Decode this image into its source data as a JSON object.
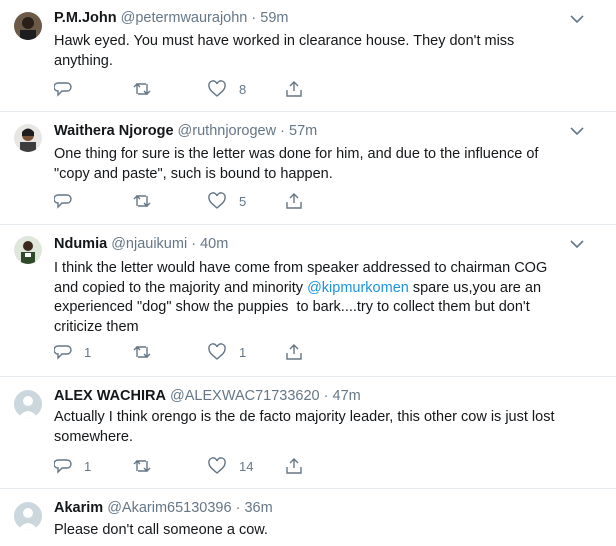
{
  "tweets": [
    {
      "name": "P.M.John",
      "handle": "@petermwaurajohn",
      "sep": "·",
      "time": "59m",
      "text": "Hawk eyed. You must have worked in clearance house. They don't miss\nanything.",
      "counts": {
        "reply": "",
        "retweet": "",
        "like": "8"
      }
    },
    {
      "name": "Waithera Njoroge",
      "handle": "@ruthnjorogew",
      "sep": "·",
      "time": "57m",
      "text": "One thing for sure is the letter was done for him, and due to the influence of\n\"copy and paste\", such is bound to happen.",
      "counts": {
        "reply": "",
        "retweet": "",
        "like": "5"
      }
    },
    {
      "name": "Ndumia",
      "handle": "@njauikumi",
      "sep": "·",
      "time": "40m",
      "text_before": "I think the letter would have come from speaker addressed to chairman COG\nand copied to the majority and minority ",
      "mention": "@kipmurkomen",
      "text_after": " spare us,you are an\nexperienced \"dog\" show the puppies  to bark....try to collect them but don't\ncriticize them",
      "counts": {
        "reply": "1",
        "retweet": "",
        "like": "1"
      }
    },
    {
      "name": "ALEX WACHIRA",
      "handle": "@ALEXWAC71733620",
      "sep": "·",
      "time": "47m",
      "text": "Actually I think orengo is the de facto majority leader, this other cow is just lost\nsomewhere.",
      "counts": {
        "reply": "1",
        "retweet": "",
        "like": "14"
      }
    },
    {
      "name": "Akarim",
      "handle": "@Akarim65130396",
      "sep": "·",
      "time": "36m",
      "text": "Please don't call someone a cow."
    }
  ],
  "icons": {
    "more": "chevron-down-icon",
    "reply": "reply-icon",
    "retweet": "retweet-icon",
    "like": "heart-icon",
    "share": "share-icon"
  },
  "colors": {
    "text": "#14171a",
    "muted": "#657786",
    "link": "#1b95e0",
    "divider": "#e6ecf0"
  }
}
